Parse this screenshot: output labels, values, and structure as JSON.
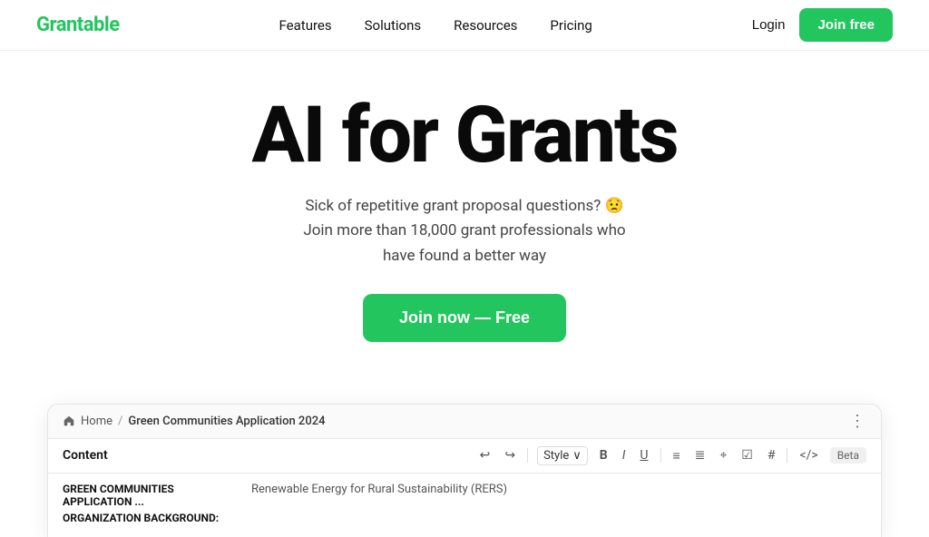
{
  "brand": {
    "logo": "Grantable",
    "logo_color": "#22c55e"
  },
  "navbar": {
    "links": [
      {
        "label": "Features",
        "href": "#"
      },
      {
        "label": "Solutions",
        "href": "#"
      },
      {
        "label": "Resources",
        "href": "#"
      },
      {
        "label": "Pricing",
        "href": "#"
      }
    ],
    "login_label": "Login",
    "join_free_label": "Join free"
  },
  "hero": {
    "title": "AI for Grants",
    "subtitle_line1": "Sick of repetitive grant proposal questions? 😟",
    "subtitle_line2": "Join more than 18,000 grant professionals who",
    "subtitle_line3": "have found a better way",
    "cta_label": "Join now — Free"
  },
  "app_preview": {
    "breadcrumb_home": "Home",
    "breadcrumb_page": "Green Communities Application 2024",
    "toolbar_content_label": "Content",
    "toolbar_style_label": "Style",
    "toolbar_beta_label": "Beta",
    "sidebar_item1": "GREEN COMMUNITIES APPLICATION ...",
    "sidebar_item2": "ORGANIZATION BACKGROUND:",
    "main_text": "Renewable Energy for Rural Sustainability (RERS)"
  },
  "icons": {
    "undo": "↩",
    "redo": "↪",
    "bold": "B",
    "italic": "I",
    "underline": "U",
    "list_ul": "≡",
    "list_ol": "≣",
    "link": "⌖",
    "checkbox": "☑",
    "hash": "#",
    "code": "</>",
    "chevron_down": "∨",
    "more_vert": "⋮"
  }
}
